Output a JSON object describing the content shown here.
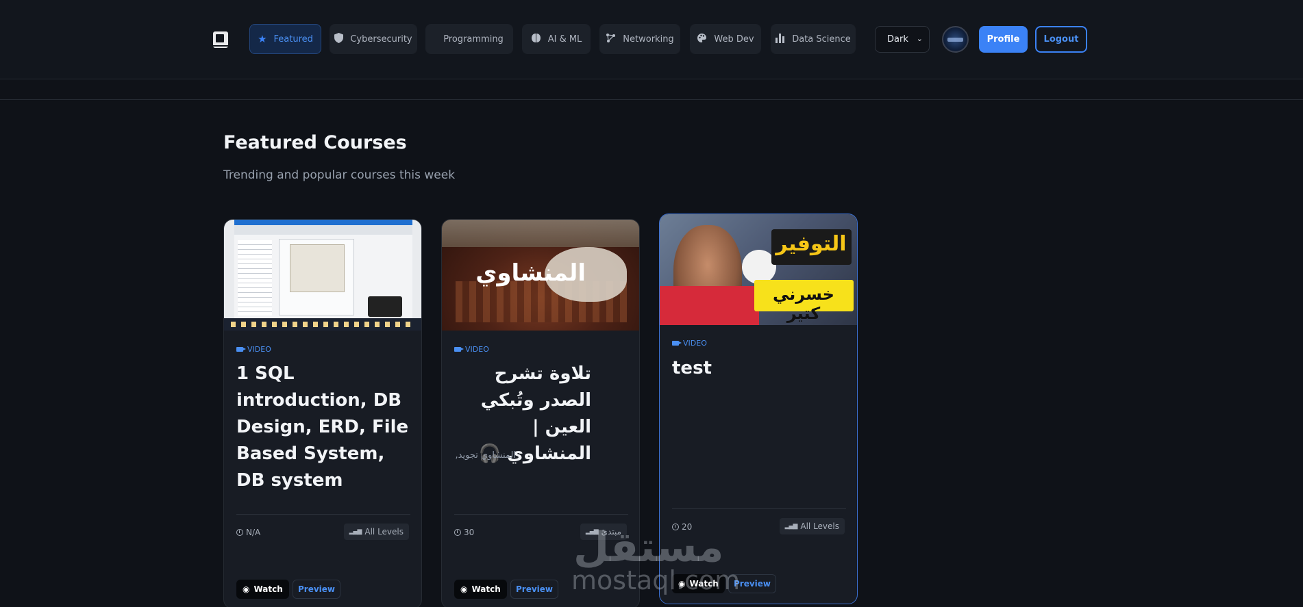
{
  "colors": {
    "accent": "#3b82f6",
    "background": "#0f1218",
    "card": "#181c24"
  },
  "nav": {
    "logo_icon": "book-icon",
    "categories": [
      {
        "label": "Featured",
        "icon": "star-icon",
        "active": true
      },
      {
        "label": "Cybersecurity",
        "icon": "shield-icon",
        "active": false
      },
      {
        "label": "Programming",
        "icon": "",
        "active": false
      },
      {
        "label": "AI & ML",
        "icon": "brain-icon",
        "active": false
      },
      {
        "label": "Networking",
        "icon": "network-icon",
        "active": false
      },
      {
        "label": "Web Dev",
        "icon": "palette-icon",
        "active": false
      },
      {
        "label": "Data Science",
        "icon": "chart-bar-icon",
        "active": false
      }
    ],
    "theme_selected": "Dark",
    "profile_label": "Profile",
    "logout_label": "Logout"
  },
  "section": {
    "title": "Featured Courses",
    "subtitle": "Trending and popular courses this week"
  },
  "courses": [
    {
      "type": "VIDEO",
      "title": "1 SQL introduction, DB Design, ERD, File Based System, DB system",
      "description": "",
      "duration": "N/A",
      "level": "All Levels",
      "watch_label": "Watch",
      "preview_label": "Preview"
    },
    {
      "type": "VIDEO",
      "title": "تلاوة تشرح الصدر وتُبكي العين | المنشاوي 🎧",
      "description": "المنشاوي تجويد,",
      "thumb_text": "المنشاوي",
      "duration": "30",
      "level": "مبتدئ",
      "watch_label": "Watch",
      "preview_label": "Preview"
    },
    {
      "type": "VIDEO",
      "title": "test",
      "description": "",
      "thumb_text_1": "التوفير",
      "thumb_text_2": "خسرني كتير",
      "duration": "20",
      "level": "All Levels",
      "watch_label": "Watch",
      "preview_label": "Preview"
    }
  ],
  "watermark": {
    "arabic": "مستقل",
    "latin": "mostaql.com"
  }
}
